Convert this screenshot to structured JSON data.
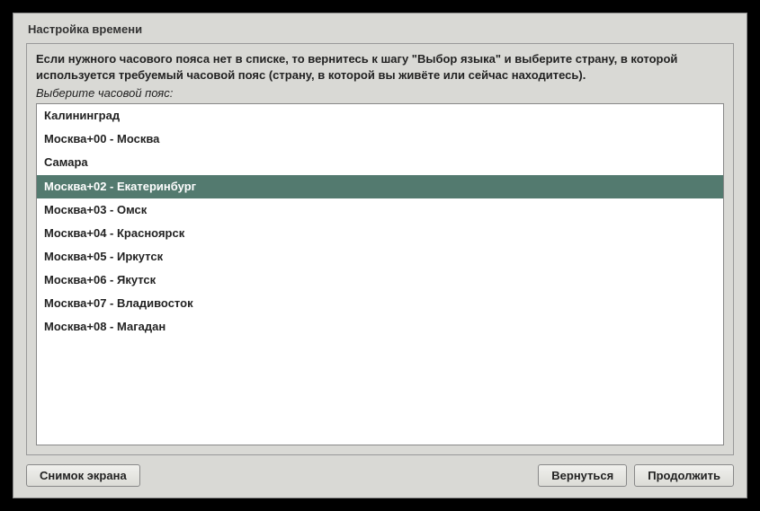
{
  "dialog": {
    "title": "Настройка времени",
    "instruction": "Если нужного часового пояса нет в списке, то вернитесь к шагу \"Выбор языка\" и выберите страну, в которой используется требуемый часовой пояс (страну, в которой вы живёте или сейчас находитесь).",
    "prompt": "Выберите часовой пояс:"
  },
  "timezones": [
    {
      "label": "Калининград",
      "selected": false
    },
    {
      "label": "Москва+00 - Москва",
      "selected": false
    },
    {
      "label": "Самара",
      "selected": false
    },
    {
      "label": "Москва+02 - Екатеринбург",
      "selected": true
    },
    {
      "label": "Москва+03 - Омск",
      "selected": false
    },
    {
      "label": "Москва+04 - Красноярск",
      "selected": false
    },
    {
      "label": "Москва+05 - Иркутск",
      "selected": false
    },
    {
      "label": "Москва+06 - Якутск",
      "selected": false
    },
    {
      "label": "Москва+07 - Владивосток",
      "selected": false
    },
    {
      "label": "Москва+08 - Магадан",
      "selected": false
    }
  ],
  "buttons": {
    "screenshot": "Снимок экрана",
    "back": "Вернуться",
    "continue": "Продолжить"
  }
}
